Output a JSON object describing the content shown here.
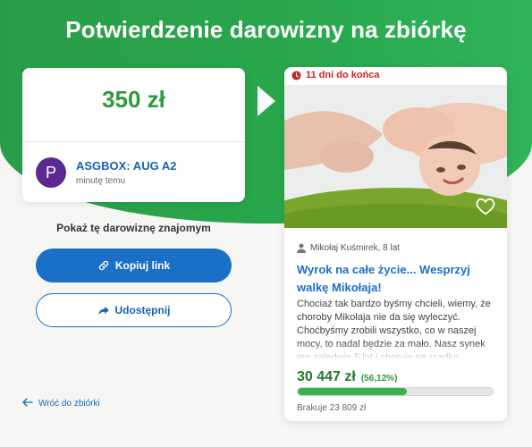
{
  "header": {
    "title": "Potwierdzenie darowizny na zbiórkę"
  },
  "donation": {
    "amount": "350 zł",
    "donor_initial": "P",
    "donor_name": "ASGBOX: AUG A2",
    "time": "minutę temu"
  },
  "share": {
    "heading": "Pokaż tę darowiznę znajomym",
    "copy_label": "Kopiuj link",
    "share_label": "Udostępnij"
  },
  "nav": {
    "back_label": "Wróć do zbiórki"
  },
  "fundraiser": {
    "days_left": "11 dni do końca",
    "organizer": "Mikołaj Kuśmirek, 8 lat",
    "title": "Wyrok na całe życie... Wesprzyj walkę Mikołaja!",
    "description": "Chociaż tak bardzo byśmy chcieli, wiemy, że choroby Mikołaja nie da się wyleczyć. Choćbyśmy zrobili wszystko, co w naszej mocy, to nadal będzie za mało. Nasz synek ma zaledwie 5 lat i choruje na rzadką",
    "raised": "30 447 zł",
    "percent_label": "(56,12%)",
    "progress_fraction": 0.5612,
    "remaining": "Brakuje 23 809 zł"
  },
  "colors": {
    "brand_green": "#2e9a3e",
    "link_blue": "#1a70c7",
    "urgent_red": "#c62828"
  }
}
